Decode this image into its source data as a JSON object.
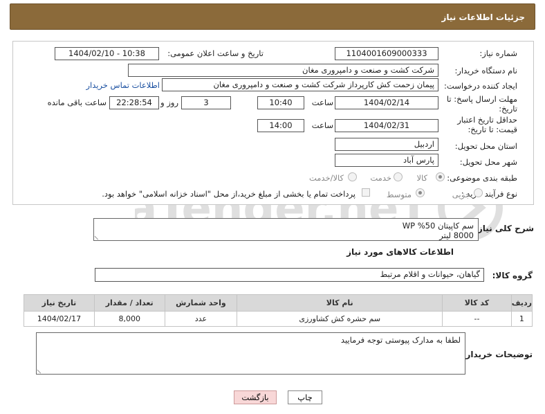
{
  "header": {
    "title": "جزئیات اطلاعات نیاز"
  },
  "fields": {
    "need_number_label": "شماره نیاز:",
    "need_number": "1104001609000333",
    "announce_label": "تاریخ و ساعت اعلان عمومی:",
    "announce_value": "1404/02/10 - 10:38",
    "buyer_org_label": "نام دستگاه خریدار:",
    "buyer_org": "شرکت کشت و صنعت و دامپروری مغان",
    "requester_label": "ایجاد کننده درخواست:",
    "requester": "پیمان زحمت کش کارپرداز شرکت کشت و صنعت و دامپروری مغان",
    "contact_link": "اطلاعات تماس خریدار",
    "reply_deadline_label": "مهلت ارسال پاسخ: تا تاریخ:",
    "reply_date": "1404/02/14",
    "time_label": "ساعت",
    "reply_time": "10:40",
    "days_value": "3",
    "days_label": "روز و",
    "remaining_time": "22:28:54",
    "remaining_label": "ساعت باقی مانده",
    "price_validity_label": "حداقل تاریخ اعتبار قیمت: تا تاریخ:",
    "price_date": "1404/02/31",
    "price_time": "14:00",
    "province_label": "استان محل تحویل:",
    "province": "اردبیل",
    "city_label": "شهر محل تحویل:",
    "city": "پارس آباد",
    "category_label": "طبقه بندی موضوعی:",
    "category_options": [
      "کالا",
      "خدمت",
      "کالا/خدمت"
    ],
    "process_label": "نوع فرآیند خرید :",
    "process_options": [
      "جزیی",
      "متوسط"
    ],
    "payment_note": "پرداخت تمام یا بخشی از مبلغ خرید،از محل \"اسناد خزانه اسلامی\" خواهد بود."
  },
  "description": {
    "label": "شرح کلی نیاز:",
    "line1": "سم کاپیتان WP %50",
    "line2": "8000 لیتر"
  },
  "goods_info_title": "اطلاعات کالاهای مورد نیاز",
  "goods_group": {
    "label": "گروه کالا:",
    "value": "گیاهان، حیوانات و اقلام مرتبط"
  },
  "table": {
    "headers": [
      "ردیف",
      "کد کالا",
      "نام کالا",
      "واحد شمارش",
      "تعداد / مقدار",
      "تاریخ نیاز"
    ],
    "rows": [
      [
        "1",
        "--",
        "سم حشره کش کشاورزی",
        "عدد",
        "8,000",
        "1404/02/17"
      ]
    ]
  },
  "buyer_notes": {
    "label": "توضیحات خریدار:",
    "text": "لطفا به مدارک پیوستی توجه فرمایید"
  },
  "buttons": {
    "print": "چاپ",
    "back": "بازگشت"
  },
  "watermark_text": "AriaTender.neT"
}
